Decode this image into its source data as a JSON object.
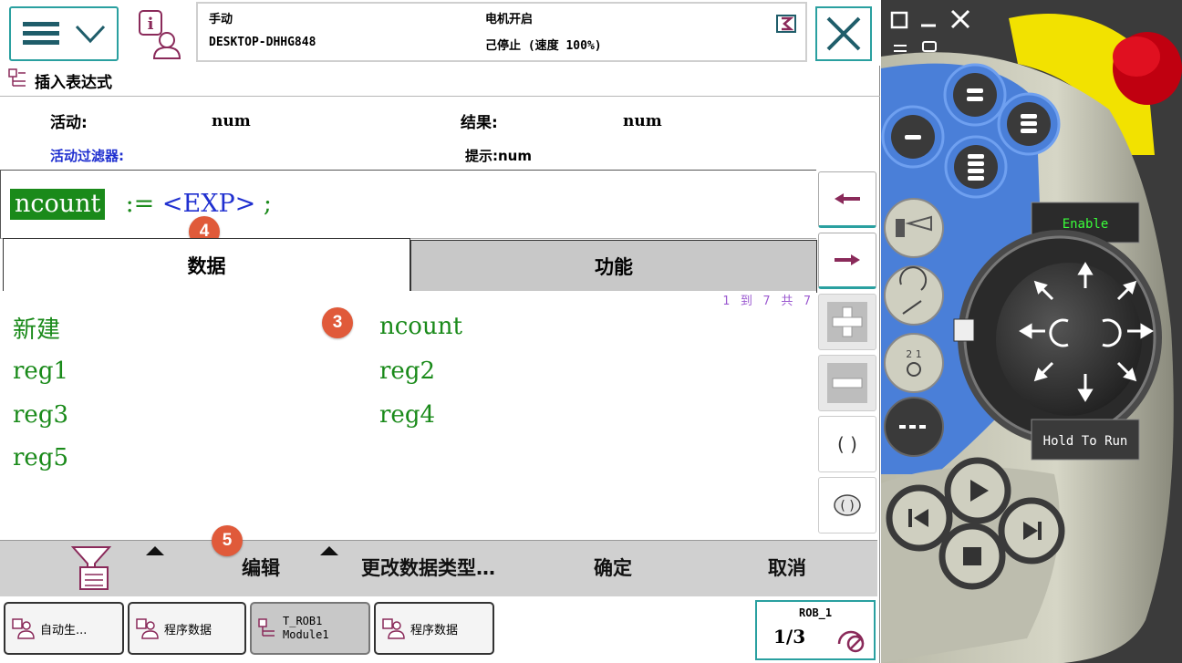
{
  "topbar": {
    "mode": "手动",
    "system_name": "DESKTOP-DHHG848",
    "motor_status": "电机开启",
    "run_status": "己停止 (速度 100%)"
  },
  "title": "插入表达式",
  "info": {
    "active_label": "活动:",
    "active_value": "num",
    "result_label": "结果:",
    "result_value": "num",
    "filter_label": "活动过滤器:",
    "hint": "提示:num"
  },
  "expression": {
    "variable": "ncount",
    "assign": " := ",
    "placeholder": "<EXP>",
    "end": " ;"
  },
  "badges": {
    "b3": "3",
    "b4": "4",
    "b5": "5"
  },
  "tabs": {
    "data": "数据",
    "function": "功能"
  },
  "list": {
    "counter": "1 到 7 共 7",
    "items": [
      "新建",
      "ncount",
      "reg1",
      "reg2",
      "reg3",
      "reg4",
      "reg5"
    ]
  },
  "side_buttons": {
    "parens": "( )",
    "oval": "( )"
  },
  "commands": {
    "edit": "编辑",
    "change_type": "更改数据类型…",
    "ok": "确定",
    "cancel": "取消"
  },
  "taskbar": {
    "t1": "自动生...",
    "t2": "程序数据",
    "t3_line1": "T_ROB1",
    "t3_line2": "Module1",
    "t4": "程序数据",
    "rob": "ROB_1",
    "fraction": "1/3"
  },
  "device": {
    "enable": "Enable",
    "hold": "Hold To Run"
  },
  "colors": {
    "teal": "#2aa0a0",
    "green": "#1a8a1a",
    "blue": "#2030d0",
    "badge": "#e05a3a",
    "device_blue": "#4a7fd8",
    "device_yellow": "#f2e200"
  }
}
